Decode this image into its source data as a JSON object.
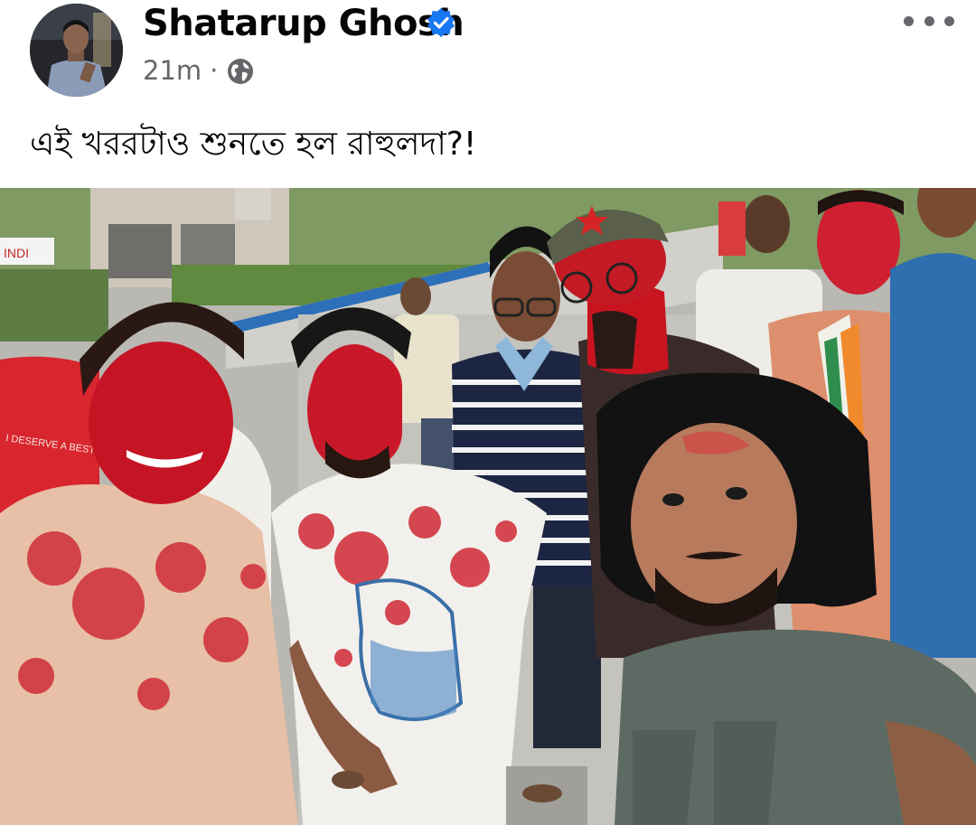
{
  "post": {
    "author_name": "Shatarup Ghosh",
    "verified_icon": "verified-badge-icon",
    "time": "21m",
    "separator": "·",
    "privacy_icon": "globe-icon",
    "more_icon": "more-options-icon",
    "caption": "এই খররটাও শুনতে হল রাহুলদা?!"
  },
  "photo_text": {
    "shirt_print": "I DESERVE A BEST CRICK",
    "shop_sign": "INDI"
  },
  "colors": {
    "name": "#050505",
    "meta": "#65676b",
    "verified_blue": "#1877f2",
    "gulal_red": "#d8192a"
  }
}
